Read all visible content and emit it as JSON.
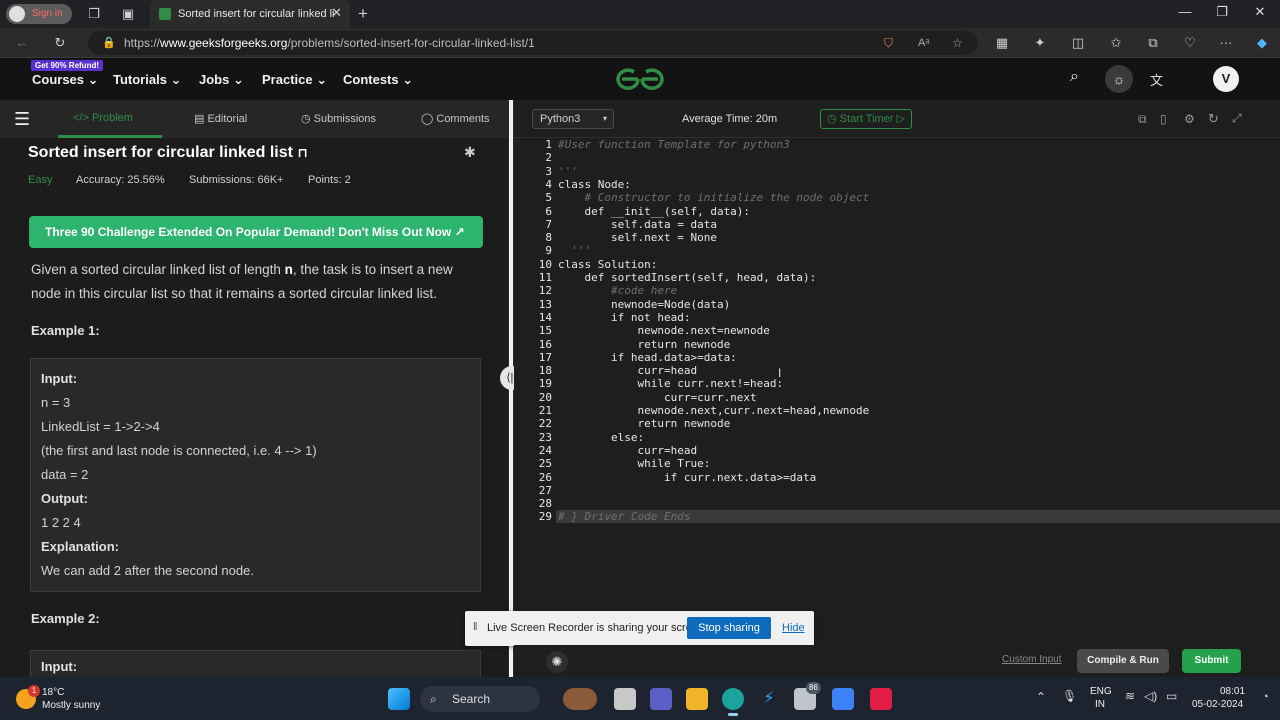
{
  "browser": {
    "profile_label": "Sign in",
    "tab_title": "Sorted insert for circular linked li",
    "url_prefix": "https://",
    "url_domain": "www.geeksforgeeks.org",
    "url_path": "/problems/sorted-insert-for-circular-linked-list/1"
  },
  "site_nav": {
    "refund_badge": "Get 90% Refund!",
    "items": [
      "Courses",
      "Tutorials",
      "Jobs",
      "Practice",
      "Contests"
    ],
    "avatar_letter": "V"
  },
  "left_tabs": [
    "Problem",
    "Editorial",
    "Submissions",
    "Comments"
  ],
  "problem": {
    "title": "Sorted insert for circular linked list",
    "difficulty": "Easy",
    "accuracy": "Accuracy: 25.56%",
    "submissions": "Submissions: 66K+",
    "points": "Points: 2",
    "banner": "Three 90 Challenge Extended On Popular Demand! Don't Miss Out Now",
    "desc_1": "Given a sorted circular linked list of length ",
    "desc_n": "n",
    "desc_2": ", the task is to insert a new",
    "desc_3": "node in this circular list so that it remains a sorted circular linked list.",
    "example1_label": "Example 1:",
    "example1": {
      "input_label": "Input:",
      "line1": "n = 3",
      "line2": "LinkedList = 1->2->4",
      "line3": "(the first and last node is connected, i.e. 4 --> 1)",
      "line4": "data = 2",
      "output_label": "Output:",
      "output": "1 2 2 4",
      "explanation_label": "Explanation:",
      "explanation": "We can add 2 after the second node."
    },
    "example2_label": "Example 2:",
    "example2_input_label": "Input:"
  },
  "editor": {
    "language": "Python3",
    "avg_time": "Average Time: 20m",
    "start_timer": "Start Timer",
    "lines": [
      "#User function Template for python3",
      "",
      "'''",
      "class Node:",
      "    # Constructor to initialize the node object",
      "    def __init__(self, data):",
      "        self.data = data",
      "        self.next = None",
      "  '''",
      "class Solution:",
      "    def sortedInsert(self, head, data):",
      "        #code here",
      "        newnode=Node(data)",
      "        if not head:",
      "            newnode.next=newnode",
      "            return newnode",
      "        if head.data>=data:",
      "            curr=head",
      "            while curr.next!=head:",
      "                curr=curr.next",
      "            newnode.next,curr.next=head,newnode",
      "            return newnode",
      "        else:",
      "            curr=head",
      "            while True:",
      "                if curr.next.data>=data",
      "",
      "",
      "# } Driver Code Ends"
    ],
    "custom_input": "Custom Input",
    "compile_run": "Compile & Run",
    "submit": "Submit"
  },
  "share_bar": {
    "message": "Live Screen Recorder is sharing your screen.",
    "stop": "Stop sharing",
    "hide": "Hide"
  },
  "taskbar": {
    "temp": "18°C",
    "weather": "Mostly sunny",
    "weather_badge": "1",
    "search": "Search",
    "notif_badge": "86",
    "lang_1": "ENG",
    "lang_2": "IN",
    "time": "08:01",
    "date": "05-02-2024"
  },
  "colors": {
    "gfg_green": "#2f8d46",
    "banner_green": "#2db46f",
    "submit_green": "#24a14a",
    "share_blue": "#0f6cbd"
  }
}
